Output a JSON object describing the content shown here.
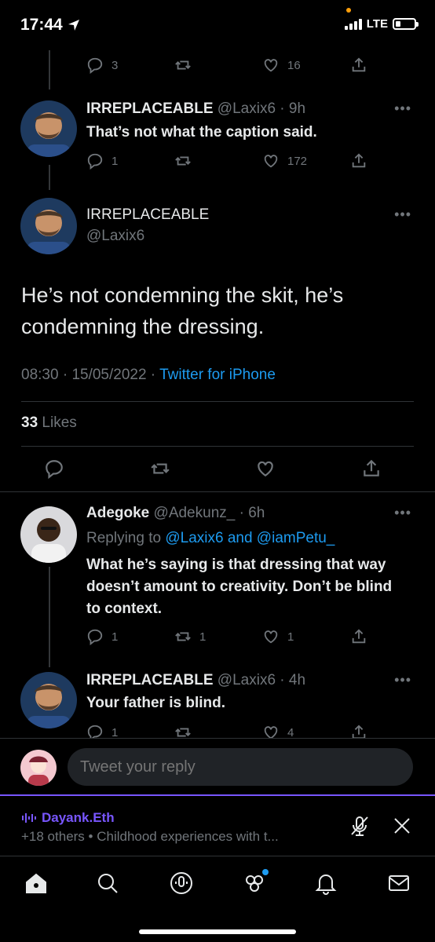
{
  "status": {
    "time": "17:44",
    "network": "LTE"
  },
  "parent_actions": {
    "replies": "3",
    "retweets": "",
    "likes": "16"
  },
  "reply1": {
    "name": "IRREPLACEABLE",
    "handle": "@Laxix6",
    "time": "· 9h",
    "text": "That’s not what the caption said.",
    "replies": "1",
    "retweets": "",
    "likes": "172"
  },
  "main_tweet": {
    "name": "IRREPLACEABLE",
    "handle": "@Laxix6",
    "text": "He’s not condemning the skit, he’s condemning the dressing.",
    "time": "08:30",
    "date": "15/05/2022",
    "source": "Twitter for iPhone",
    "likes_count": "33",
    "likes_label": "Likes"
  },
  "reply2": {
    "name": "Adegoke",
    "handle": "@Adekunz_",
    "time": "· 6h",
    "replying_prefix": "Replying to",
    "replying_to": "@Laxix6 and @iamPetu_",
    "text": "What he’s saying is that dressing that way doesn’t amount to creativity. Don’t be blind to context.",
    "replies": "1",
    "retweets": "1",
    "likes": "1"
  },
  "reply3": {
    "name": "IRREPLACEABLE",
    "handle": "@Laxix6",
    "time": "· 4h",
    "text": "Your father is blind.",
    "replies": "1",
    "retweets": "",
    "likes": "4"
  },
  "reply_bar": {
    "placeholder": "Tweet your reply"
  },
  "spaces": {
    "host": "Dayank.Eth",
    "subtitle": "+18 others • Childhood experiences with t..."
  },
  "colors": {
    "accent": "#1d9bf0",
    "spaces": "#7856ff",
    "muted": "#71767b"
  }
}
